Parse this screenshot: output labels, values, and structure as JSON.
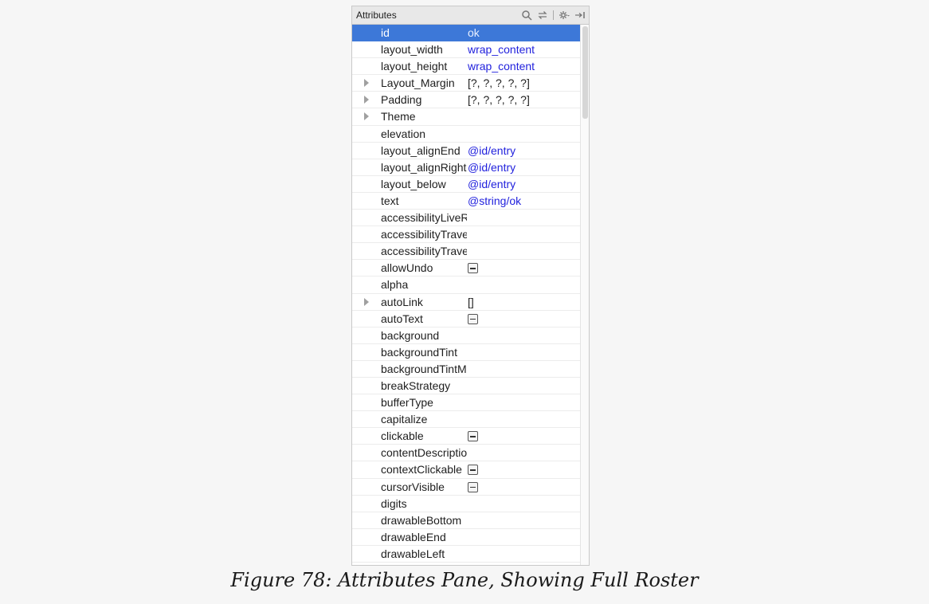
{
  "panel": {
    "title": "Attributes",
    "icons": [
      "search-icon",
      "swap-icon",
      "gear-icon",
      "pin-icon"
    ]
  },
  "rows": [
    {
      "name": "id",
      "value": "ok",
      "selected": true
    },
    {
      "name": "layout_width",
      "value": "wrap_content"
    },
    {
      "name": "layout_height",
      "value": "wrap_content"
    },
    {
      "name": "Layout_Margin",
      "value": "[?, ?, ?, ?, ?]",
      "expandable": true,
      "plain": true
    },
    {
      "name": "Padding",
      "value": "[?, ?, ?, ?, ?]",
      "expandable": true,
      "plain": true
    },
    {
      "name": "Theme",
      "value": "",
      "expandable": true
    },
    {
      "name": "elevation",
      "value": ""
    },
    {
      "name": "layout_alignEnd",
      "value": "@id/entry"
    },
    {
      "name": "layout_alignRight",
      "value": "@id/entry"
    },
    {
      "name": "layout_below",
      "value": "@id/entry"
    },
    {
      "name": "text",
      "value": "@string/ok"
    },
    {
      "name": "accessibilityLiveRegion",
      "value": ""
    },
    {
      "name": "accessibilityTraversalAfter",
      "value": ""
    },
    {
      "name": "accessibilityTraversalBefore",
      "value": ""
    },
    {
      "name": "allowUndo",
      "value": "",
      "checkbox": true
    },
    {
      "name": "alpha",
      "value": ""
    },
    {
      "name": "autoLink",
      "value": "[]",
      "expandable": true,
      "plain": true
    },
    {
      "name": "autoText",
      "value": "",
      "checkbox": true
    },
    {
      "name": "background",
      "value": ""
    },
    {
      "name": "backgroundTint",
      "value": ""
    },
    {
      "name": "backgroundTintMode",
      "value": ""
    },
    {
      "name": "breakStrategy",
      "value": ""
    },
    {
      "name": "bufferType",
      "value": ""
    },
    {
      "name": "capitalize",
      "value": ""
    },
    {
      "name": "clickable",
      "value": "",
      "checkbox": true
    },
    {
      "name": "contentDescription",
      "value": ""
    },
    {
      "name": "contextClickable",
      "value": "",
      "checkbox": true
    },
    {
      "name": "cursorVisible",
      "value": "",
      "checkbox": true
    },
    {
      "name": "digits",
      "value": ""
    },
    {
      "name": "drawableBottom",
      "value": ""
    },
    {
      "name": "drawableEnd",
      "value": ""
    },
    {
      "name": "drawableLeft",
      "value": ""
    }
  ],
  "caption": "Figure 78: Attributes Pane, Showing Full Roster"
}
